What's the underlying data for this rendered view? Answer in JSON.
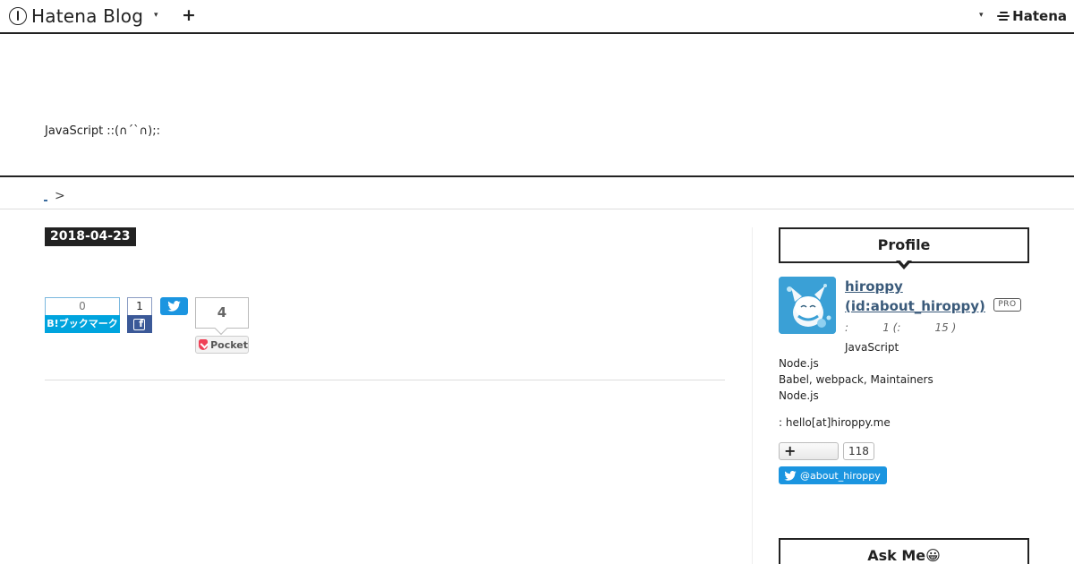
{
  "global_header": {
    "logo_text": "Hatena Blog",
    "caret": "▾",
    "plus": "+",
    "brand": "Hatena"
  },
  "blog": {
    "description": "JavaScript ::(∩´`∩);:"
  },
  "breadcrumb": {
    "separator": ">"
  },
  "entry": {
    "date": "2018-04-23",
    "share": {
      "hatena_bookmark_count": "0",
      "hatena_bookmark_label": "B!ブックマーク",
      "facebook_count": "1",
      "pocket_count": "4",
      "pocket_label": "Pocket"
    }
  },
  "sidebar": {
    "profile": {
      "title": "Profile",
      "display_name": "hiroppy",
      "user_id": "(id:about_hiroppy)",
      "badge": "PRO",
      "meta": ":          1 (:          15 )",
      "bio_first": "JavaScript",
      "lines": [
        "Node.js",
        "Babel, webpack, Maintainers",
        "Node.js"
      ],
      "contact": ": hello[at]hiroppy.me",
      "follow_count": "118",
      "twitter_follow": "@about_hiroppy"
    },
    "askme": {
      "title": "Ask Me😀"
    }
  },
  "colors": {
    "hatena_bookmark": "#00a4de",
    "facebook": "#3b5998",
    "twitter": "#1b95e0",
    "pocket": "#ef4056",
    "link": "#3a5a7a"
  }
}
